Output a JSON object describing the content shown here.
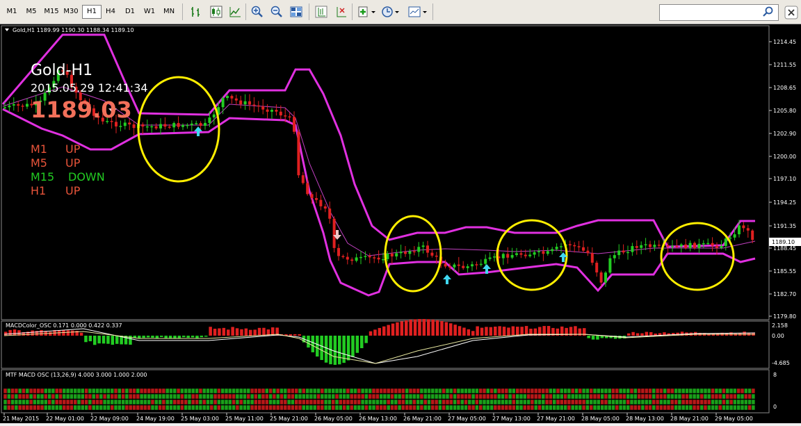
{
  "toolbar": {
    "timeframes": [
      "M1",
      "M5",
      "M15",
      "M30",
      "H1",
      "H4",
      "D1",
      "W1",
      "MN"
    ],
    "active_timeframe": "H1",
    "icons": [
      "bar-chart-icon",
      "candlestick-icon",
      "line-chart-icon",
      "zoom-in-icon",
      "zoom-out-icon",
      "tile-windows-icon",
      "period-separator-icon",
      "crosshair-icon",
      "indicators-icon",
      "clock-icon",
      "templates-icon"
    ],
    "search_placeholder": ""
  },
  "chart": {
    "header": "Gold,H1  1189.99 1190.30 1188.34 1189.10",
    "symbol_title": "Gold-H1",
    "datetime": "2015.05.29 12:41:34",
    "price_big": "1189.03",
    "signals": [
      {
        "tf": "M1",
        "dir": "UP",
        "color": "#e8543a"
      },
      {
        "tf": "M5",
        "dir": "UP",
        "color": "#e8543a"
      },
      {
        "tf": "M15",
        "dir": "DOWN",
        "color": "#22cc22"
      },
      {
        "tf": "H1",
        "dir": "UP",
        "color": "#e8543a"
      }
    ],
    "price_axis": [
      "1214.45",
      "1211.55",
      "1208.65",
      "1205.80",
      "1202.90",
      "1200.00",
      "1197.10",
      "1194.25",
      "1191.35",
      "1188.45",
      "1185.55",
      "1182.70",
      "1179.80"
    ],
    "current_price_label": "1189.10",
    "macd_header": "MACDColor_OSC 0.171 0.000 0.422 0.337",
    "macd_axis": [
      "2.158",
      "0.00",
      "-4.685"
    ],
    "mtf_header": "MTF MACD OSC (13,26,9) 4.000 3.000 1.000 2.000",
    "mtf_axis": [
      "8",
      "0"
    ],
    "time_axis": [
      "21 May 2015",
      "22 May 01:00",
      "22 May 09:00",
      "24 May 19:00",
      "25 May 03:00",
      "25 May 11:00",
      "25 May 21:00",
      "26 May 05:00",
      "26 May 13:00",
      "26 May 21:00",
      "27 May 05:00",
      "27 May 13:00",
      "27 May 21:00",
      "28 May 05:00",
      "28 May 13:00",
      "28 May 21:00",
      "29 May 05:00"
    ],
    "colors": {
      "bull": "#22cc22",
      "bear": "#e02020",
      "band": "#e030e0",
      "mid": "#c040c0",
      "highlight": "#ffee00",
      "arrow_up": "#40d8f0",
      "arrow_down": "#f0c8c8"
    }
  }
}
